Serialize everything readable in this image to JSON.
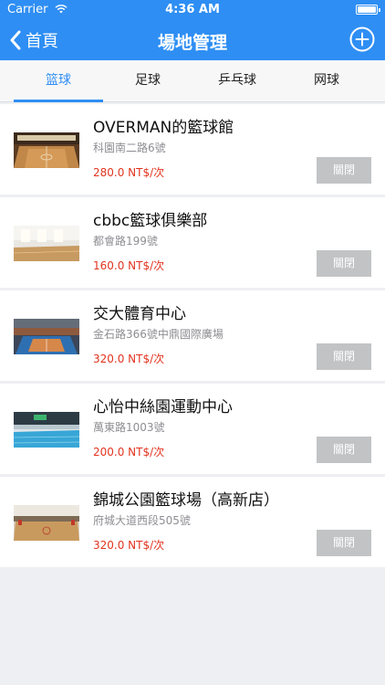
{
  "status_bar": {
    "carrier": "Carrier",
    "time": "4:36 AM"
  },
  "nav": {
    "back_label": "首頁",
    "title": "場地管理"
  },
  "tabs": [
    {
      "label": "篮球",
      "active": true
    },
    {
      "label": "足球",
      "active": false
    },
    {
      "label": "乒乓球",
      "active": false
    },
    {
      "label": "网球",
      "active": false
    }
  ],
  "venues": [
    {
      "name": "OVERMAN的籃球館",
      "address": "科園南二路6號",
      "price": "280.0 NT$/次",
      "button": "關閉",
      "thumb_icon": "basketball-court-photo"
    },
    {
      "name": "cbbc籃球俱樂部",
      "address": "都會路199號",
      "price": "160.0 NT$/次",
      "button": "關閉",
      "thumb_icon": "indoor-hall-photo"
    },
    {
      "name": "交大體育中心",
      "address": "金石路366號中鼎國際廣場",
      "price": "320.0 NT$/次",
      "button": "關閉",
      "thumb_icon": "sports-center-photo"
    },
    {
      "name": "心怡中絲園運動中心",
      "address": "萬東路1003號",
      "price": "200.0 NT$/次",
      "button": "關閉",
      "thumb_icon": "swimming-pool-photo"
    },
    {
      "name": "錦城公園籃球場（高新店）",
      "address": "府城大道西段505號",
      "price": "320.0 NT$/次",
      "button": "關閉",
      "thumb_icon": "arena-photo"
    }
  ],
  "colors": {
    "primary": "#2e8ef3",
    "price": "#e2341f",
    "button_disabled": "#c2c3c5",
    "background": "#eeeff2"
  }
}
